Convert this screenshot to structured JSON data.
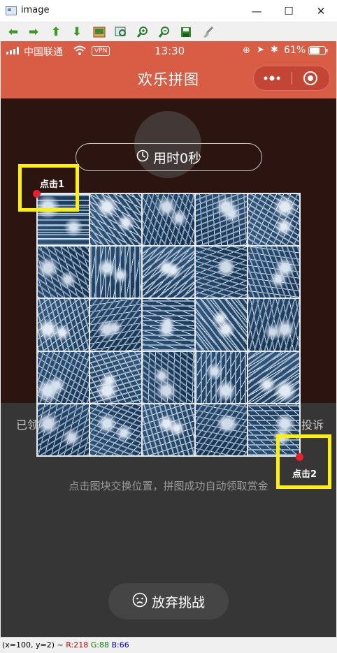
{
  "window": {
    "title": "image"
  },
  "toolbar": {
    "icons": [
      "arrow-left-icon",
      "arrow-right-icon",
      "arrow-up-icon",
      "arrow-down-icon",
      "image-icon",
      "image-zoom-icon",
      "zoom-in-icon",
      "zoom-out-icon",
      "save-icon",
      "brush-icon"
    ]
  },
  "statusbar": {
    "carrier": "中国联通",
    "vpn": "VPN",
    "time": "13:30",
    "battery": "61%"
  },
  "navbar": {
    "title": "欢乐拼图"
  },
  "timer": {
    "label": "用时0秒"
  },
  "hidden_text": {
    "left": "已领",
    "right": "投诉"
  },
  "hint": "点击图块交换位置，拼图成功自动领取赏金",
  "giveup": {
    "label": "放弃挑战"
  },
  "annotations": {
    "click1": "点击1",
    "click2": "点击2"
  },
  "viewer_status": {
    "coords": "(x=100, y=2) ~",
    "r": "R:218",
    "g": "G:88",
    "b": "B:66"
  },
  "colors": {
    "navbar": "#d95c45",
    "annotation": "#fff200",
    "dot": "#e8202a",
    "board": "#2c1410"
  }
}
